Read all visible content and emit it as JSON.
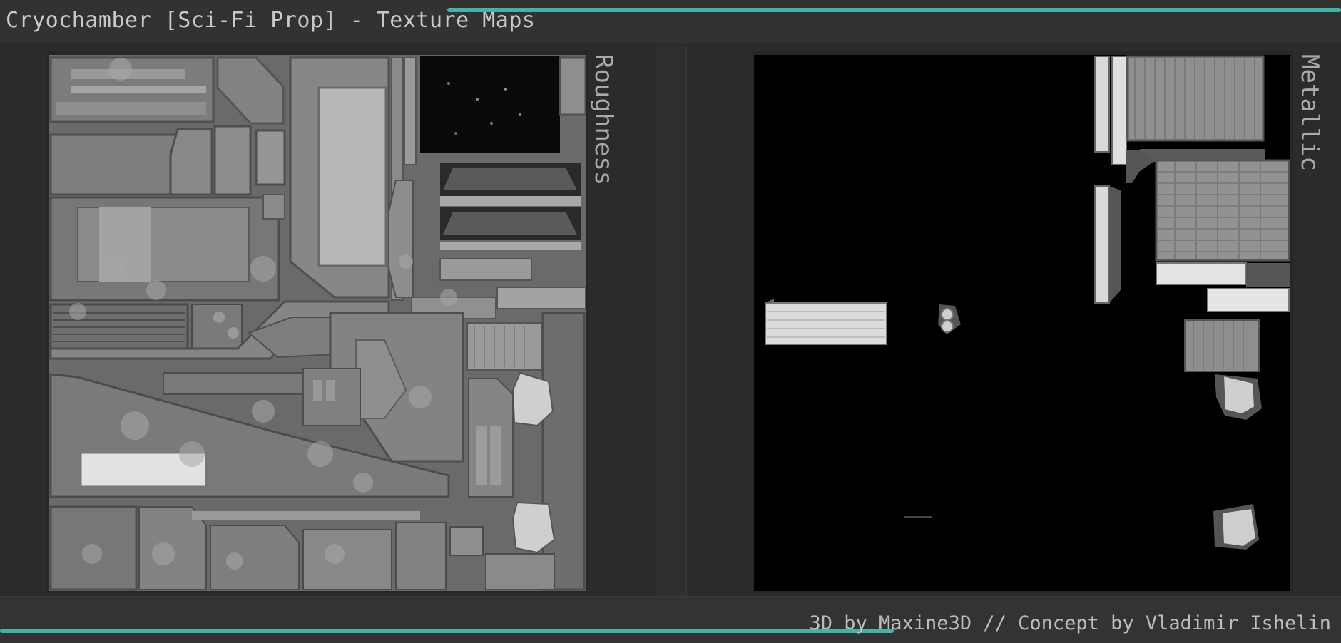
{
  "header": {
    "title": "Cryochamber [Sci-Fi Prop] - Texture Maps"
  },
  "maps": [
    {
      "label": "Roughness"
    },
    {
      "label": "Metallic"
    }
  ],
  "footer": {
    "credits": "3D by Maxine3D // Concept by Vladimir Ishelin"
  },
  "colors": {
    "accent": "#3fb5a6",
    "background": "#2b2b2b",
    "text": "#c9c9c9"
  }
}
